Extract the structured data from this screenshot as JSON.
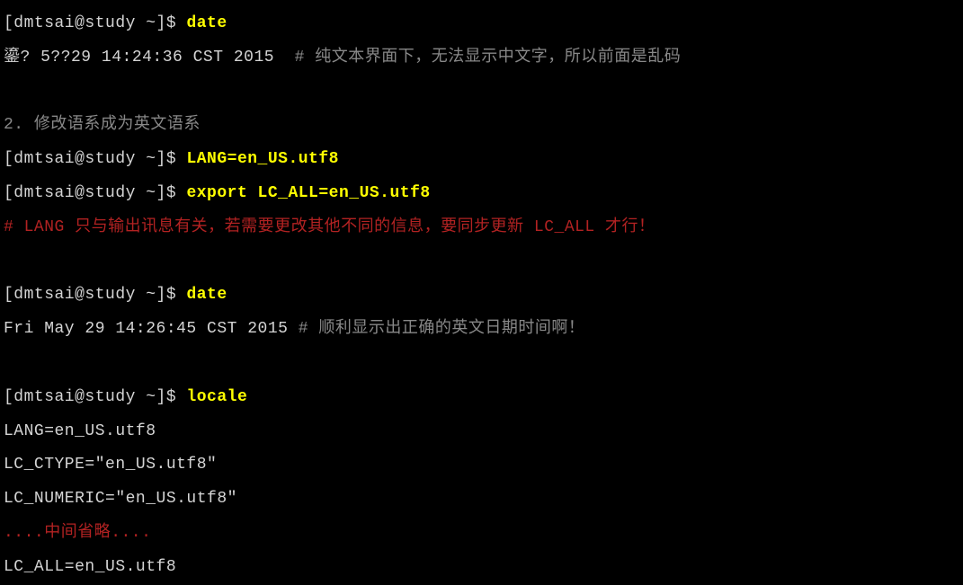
{
  "lines": {
    "l1_prompt": "[dmtsai@study ~]$ ",
    "l1_cmd": "date",
    "l2_output": "鎏? 5??29 14:24:36 CST 2015  ",
    "l2_comment": "# 纯文本界面下，无法显示中文字，所以前面是乱码",
    "l4_text": "2. 修改语系成为英文语系",
    "l5_prompt": "[dmtsai@study ~]$ ",
    "l5_cmd": "LANG=en_US.utf8",
    "l6_prompt": "[dmtsai@study ~]$ ",
    "l6_cmd": "export LC_ALL=en_US.utf8",
    "l7_redcomment": "# LANG 只与输出讯息有关，若需要更改其他不同的信息，要同步更新 LC_ALL 才行！",
    "l9_prompt": "[dmtsai@study ~]$ ",
    "l9_cmd": "date",
    "l10_output": "Fri May 29 14:26:45 CST 2015 ",
    "l10_comment": "# 顺利显示出正确的英文日期时间啊！",
    "l12_prompt": "[dmtsai@study ~]$ ",
    "l12_cmd": "locale",
    "l13_output": "LANG=en_US.utf8",
    "l14_output": "LC_CTYPE=\"en_US.utf8\"",
    "l15_output": "LC_NUMERIC=\"en_US.utf8\"",
    "l16_redcomment": "....中间省略....",
    "l17_output": "LC_ALL=en_US.utf8"
  }
}
